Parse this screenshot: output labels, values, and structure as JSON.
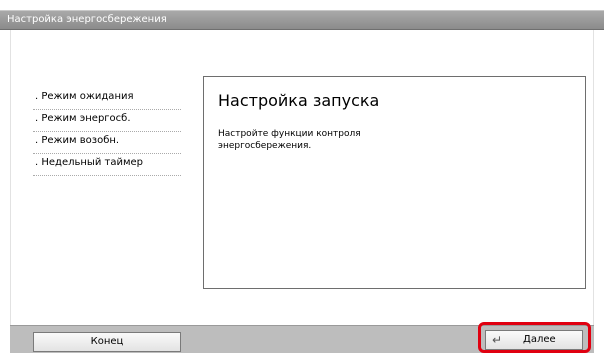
{
  "window": {
    "title": "Настройка энергосбережения"
  },
  "menu": {
    "items": [
      {
        "label": ". Режим ожидания"
      },
      {
        "label": ". Режим энергосб."
      },
      {
        "label": ". Режим возобн."
      },
      {
        "label": ". Недельный таймер"
      }
    ]
  },
  "content": {
    "title": "Настройка запуска",
    "description": "Настройте функции контроля энергосбережения."
  },
  "footer": {
    "end_label": "Конец",
    "next_label": "Далее",
    "next_icon": "return-arrow-icon"
  },
  "colors": {
    "highlight": "#e00010",
    "titlebar": "#9a9a9a",
    "footer": "#bdbdbd"
  }
}
